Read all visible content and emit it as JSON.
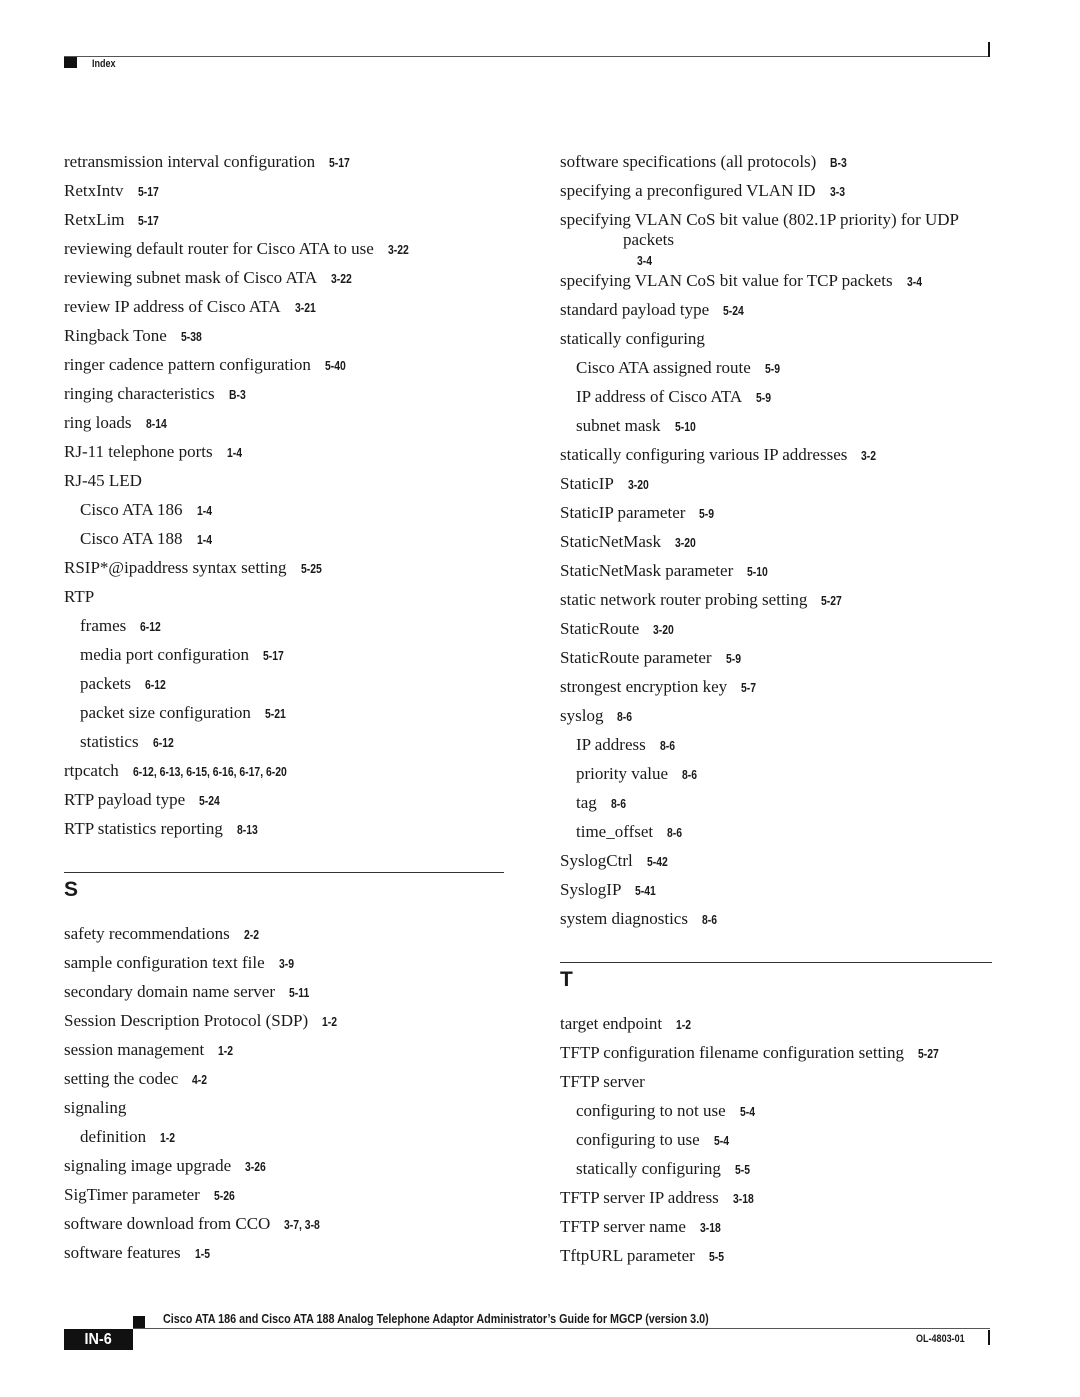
{
  "header": {
    "section_label": "Index"
  },
  "left_column": [
    {
      "term": "retransmission interval configuration",
      "pages": "5-17",
      "level": 0
    },
    {
      "term": "RetxIntv",
      "pages": "5-17",
      "level": 0
    },
    {
      "term": "RetxLim",
      "pages": "5-17",
      "level": 0
    },
    {
      "term": "reviewing default router for Cisco ATA to use",
      "pages": "3-22",
      "level": 0
    },
    {
      "term": "reviewing subnet mask of Cisco ATA",
      "pages": "3-22",
      "level": 0
    },
    {
      "term": "review IP address of Cisco ATA",
      "pages": "3-21",
      "level": 0
    },
    {
      "term": "Ringback Tone",
      "pages": "5-38",
      "level": 0
    },
    {
      "term": "ringer cadence pattern configuration",
      "pages": "5-40",
      "level": 0
    },
    {
      "term": "ringing characteristics",
      "pages": "B-3",
      "level": 0
    },
    {
      "term": "ring loads",
      "pages": "8-14",
      "level": 0
    },
    {
      "term": "RJ-11 telephone ports",
      "pages": "1-4",
      "level": 0
    },
    {
      "term": "RJ-45 LED",
      "pages": "",
      "level": 0
    },
    {
      "term": "Cisco ATA 186",
      "pages": "1-4",
      "level": 1
    },
    {
      "term": "Cisco ATA 188",
      "pages": "1-4",
      "level": 1
    },
    {
      "term": "RSIP*@ipaddress syntax setting",
      "pages": "5-25",
      "level": 0
    },
    {
      "term": "RTP",
      "pages": "",
      "level": 0
    },
    {
      "term": "frames",
      "pages": "6-12",
      "level": 1
    },
    {
      "term": "media port configuration",
      "pages": "5-17",
      "level": 1
    },
    {
      "term": "packets",
      "pages": "6-12",
      "level": 1
    },
    {
      "term": "packet size configuration",
      "pages": "5-21",
      "level": 1
    },
    {
      "term": "statistics",
      "pages": "6-12",
      "level": 1
    },
    {
      "term": "rtpcatch",
      "pages": "6-12, 6-13, 6-15, 6-16, 6-17, 6-20",
      "level": 0
    },
    {
      "term": "RTP payload type",
      "pages": "5-24",
      "level": 0
    },
    {
      "term": "RTP statistics reporting",
      "pages": "8-13",
      "level": 0
    }
  ],
  "section_s": {
    "letter": "S",
    "entries": [
      {
        "term": "safety recommendations",
        "pages": "2-2",
        "level": 0
      },
      {
        "term": "sample configuration text file",
        "pages": "3-9",
        "level": 0
      },
      {
        "term": "secondary domain name server",
        "pages": "5-11",
        "level": 0
      },
      {
        "term": "Session Description Protocol (SDP)",
        "pages": "1-2",
        "level": 0
      },
      {
        "term": "session management",
        "pages": "1-2",
        "level": 0
      },
      {
        "term": "setting the codec",
        "pages": "4-2",
        "level": 0
      },
      {
        "term": "signaling",
        "pages": "",
        "level": 0
      },
      {
        "term": "definition",
        "pages": "1-2",
        "level": 1
      },
      {
        "term": "signaling image upgrade",
        "pages": "3-26",
        "level": 0
      },
      {
        "term": "SigTimer parameter",
        "pages": "5-26",
        "level": 0
      },
      {
        "term": "software download from CCO",
        "pages": "3-7, 3-8",
        "level": 0
      },
      {
        "term": "software features",
        "pages": "1-5",
        "level": 0
      }
    ]
  },
  "right_column": [
    {
      "term": "software specifications (all protocols)",
      "pages": "B-3",
      "level": 0
    },
    {
      "term": "specifying a preconfigured VLAN ID",
      "pages": "3-3",
      "level": 0
    },
    {
      "term": "specifying VLAN CoS bit value (802.1P priority) for UDP",
      "continuation": "packets",
      "pages": "3-4",
      "level": 0
    },
    {
      "term": "specifying VLAN CoS bit value for TCP packets",
      "pages": "3-4",
      "level": 0
    },
    {
      "term": "standard payload type",
      "pages": "5-24",
      "level": 0
    },
    {
      "term": "statically configuring",
      "pages": "",
      "level": 0
    },
    {
      "term": "Cisco ATA assigned route",
      "pages": "5-9",
      "level": 1
    },
    {
      "term": "IP address of Cisco ATA",
      "pages": "5-9",
      "level": 1
    },
    {
      "term": "subnet mask",
      "pages": "5-10",
      "level": 1
    },
    {
      "term": "statically configuring various IP addresses",
      "pages": "3-2",
      "level": 0
    },
    {
      "term": "StaticIP",
      "pages": "3-20",
      "level": 0
    },
    {
      "term": "StaticIP parameter",
      "pages": "5-9",
      "level": 0
    },
    {
      "term": "StaticNetMask",
      "pages": "3-20",
      "level": 0
    },
    {
      "term": "StaticNetMask parameter",
      "pages": "5-10",
      "level": 0
    },
    {
      "term": "static network router probing setting",
      "pages": "5-27",
      "level": 0
    },
    {
      "term": "StaticRoute",
      "pages": "3-20",
      "level": 0
    },
    {
      "term": "StaticRoute parameter",
      "pages": "5-9",
      "level": 0
    },
    {
      "term": "strongest encryption key",
      "pages": "5-7",
      "level": 0
    },
    {
      "term": "syslog",
      "pages": "8-6",
      "level": 0
    },
    {
      "term": "IP address",
      "pages": "8-6",
      "level": 1
    },
    {
      "term": "priority value",
      "pages": "8-6",
      "level": 1
    },
    {
      "term": "tag",
      "pages": "8-6",
      "level": 1
    },
    {
      "term": "time_offset",
      "pages": "8-6",
      "level": 1
    },
    {
      "term": "SyslogCtrl",
      "pages": "5-42",
      "level": 0
    },
    {
      "term": "SyslogIP",
      "pages": "5-41",
      "level": 0
    },
    {
      "term": "system diagnostics",
      "pages": "8-6",
      "level": 0
    }
  ],
  "section_t": {
    "letter": "T",
    "entries": [
      {
        "term": "target endpoint",
        "pages": "1-2",
        "level": 0
      },
      {
        "term": "TFTP configuration filename configuration setting",
        "pages": "5-27",
        "level": 0
      },
      {
        "term": "TFTP server",
        "pages": "",
        "level": 0
      },
      {
        "term": "configuring to not use",
        "pages": "5-4",
        "level": 1
      },
      {
        "term": "configuring to use",
        "pages": "5-4",
        "level": 1
      },
      {
        "term": "statically configuring",
        "pages": "5-5",
        "level": 1
      },
      {
        "term": "TFTP server IP address",
        "pages": "3-18",
        "level": 0
      },
      {
        "term": "TFTP server name",
        "pages": "3-18",
        "level": 0
      },
      {
        "term": "TftpURL parameter",
        "pages": "5-5",
        "level": 0
      }
    ]
  },
  "footer": {
    "book_title": "Cisco ATA 186 and Cisco ATA 188 Analog Telephone Adaptor Administrator’s Guide for MGCP (version 3.0)",
    "page_number": "IN-6",
    "doc_number": "OL-4803-01"
  }
}
